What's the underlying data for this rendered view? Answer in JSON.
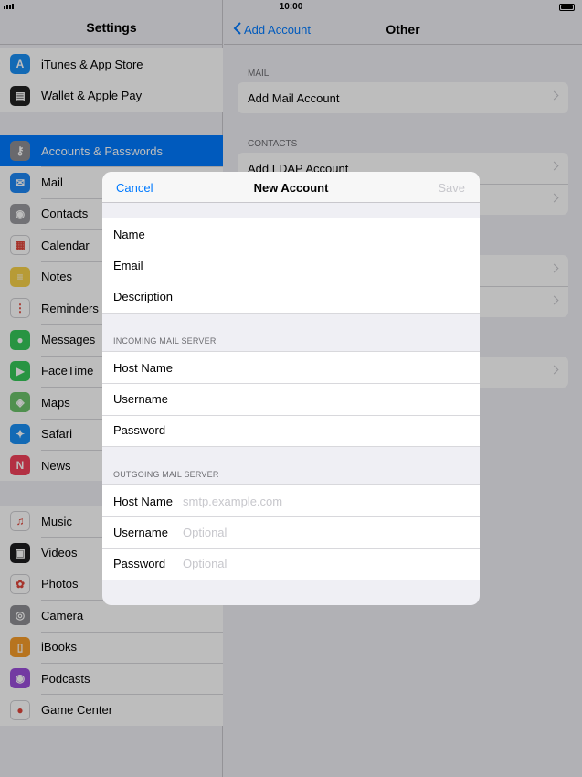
{
  "status": {
    "time": "10:00"
  },
  "sidebar": {
    "title": "Settings",
    "group1": [
      {
        "label": "iTunes & App Store",
        "icon": "app-store-icon",
        "color": "#1a8ff5",
        "glyph": "A"
      },
      {
        "label": "Wallet & Apple Pay",
        "icon": "wallet-icon",
        "color": "#222222",
        "glyph": "▤"
      }
    ],
    "group2": [
      {
        "label": "Accounts & Passwords",
        "icon": "key-icon",
        "color": "#8e8e93",
        "glyph": "⚷",
        "selected": true
      },
      {
        "label": "Mail",
        "icon": "mail-icon",
        "color": "#1e88f5",
        "glyph": "✉"
      },
      {
        "label": "Contacts",
        "icon": "contacts-icon",
        "color": "#9a9a9f",
        "glyph": "◉"
      },
      {
        "label": "Calendar",
        "icon": "calendar-icon",
        "color": "#ffffff",
        "glyph": "▦"
      },
      {
        "label": "Notes",
        "icon": "notes-icon",
        "color": "#f7d24a",
        "glyph": "≡"
      },
      {
        "label": "Reminders",
        "icon": "reminders-icon",
        "color": "#ffffff",
        "glyph": "⋮"
      },
      {
        "label": "Messages",
        "icon": "messages-icon",
        "color": "#36c85a",
        "glyph": "●"
      },
      {
        "label": "FaceTime",
        "icon": "facetime-icon",
        "color": "#36c85a",
        "glyph": "▶"
      },
      {
        "label": "Maps",
        "icon": "maps-icon",
        "color": "#6cc36b",
        "glyph": "◈"
      },
      {
        "label": "Safari",
        "icon": "safari-icon",
        "color": "#1a8ff5",
        "glyph": "✦"
      },
      {
        "label": "News",
        "icon": "news-icon",
        "color": "#f2425b",
        "glyph": "N"
      }
    ],
    "group3": [
      {
        "label": "Music",
        "icon": "music-icon",
        "color": "#ffffff",
        "glyph": "♫"
      },
      {
        "label": "Videos",
        "icon": "videos-icon",
        "color": "#1d1d20",
        "glyph": "▣"
      },
      {
        "label": "Photos",
        "icon": "photos-icon",
        "color": "#ffffff",
        "glyph": "✿"
      },
      {
        "label": "Camera",
        "icon": "camera-icon",
        "color": "#8e8e93",
        "glyph": "◎"
      },
      {
        "label": "iBooks",
        "icon": "ibooks-icon",
        "color": "#f79d2a",
        "glyph": "▯"
      },
      {
        "label": "Podcasts",
        "icon": "podcasts-icon",
        "color": "#9b4fdb",
        "glyph": "◉"
      },
      {
        "label": "Game Center",
        "icon": "game-center-icon",
        "color": "#ffffff",
        "glyph": "●"
      }
    ]
  },
  "pane": {
    "back_label": "Add Account",
    "title": "Other",
    "mail_header": "MAIL",
    "mail_items": [
      "Add Mail Account"
    ],
    "contacts_header": "CONTACTS",
    "contacts_items": [
      "Add LDAP Account",
      ""
    ]
  },
  "modal": {
    "cancel_label": "Cancel",
    "title": "New Account",
    "save_label": "Save",
    "fields": [
      {
        "label": "Name",
        "placeholder": ""
      },
      {
        "label": "Email",
        "placeholder": ""
      },
      {
        "label": "Description",
        "placeholder": ""
      }
    ],
    "incoming_header": "INCOMING MAIL SERVER",
    "incoming": [
      {
        "label": "Host Name",
        "placeholder": ""
      },
      {
        "label": "Username",
        "placeholder": ""
      },
      {
        "label": "Password",
        "placeholder": ""
      }
    ],
    "outgoing_header": "OUTGOING MAIL SERVER",
    "outgoing": [
      {
        "label": "Host Name",
        "placeholder": "smtp.example.com"
      },
      {
        "label": "Username",
        "placeholder": "Optional"
      },
      {
        "label": "Password",
        "placeholder": "Optional"
      }
    ]
  }
}
